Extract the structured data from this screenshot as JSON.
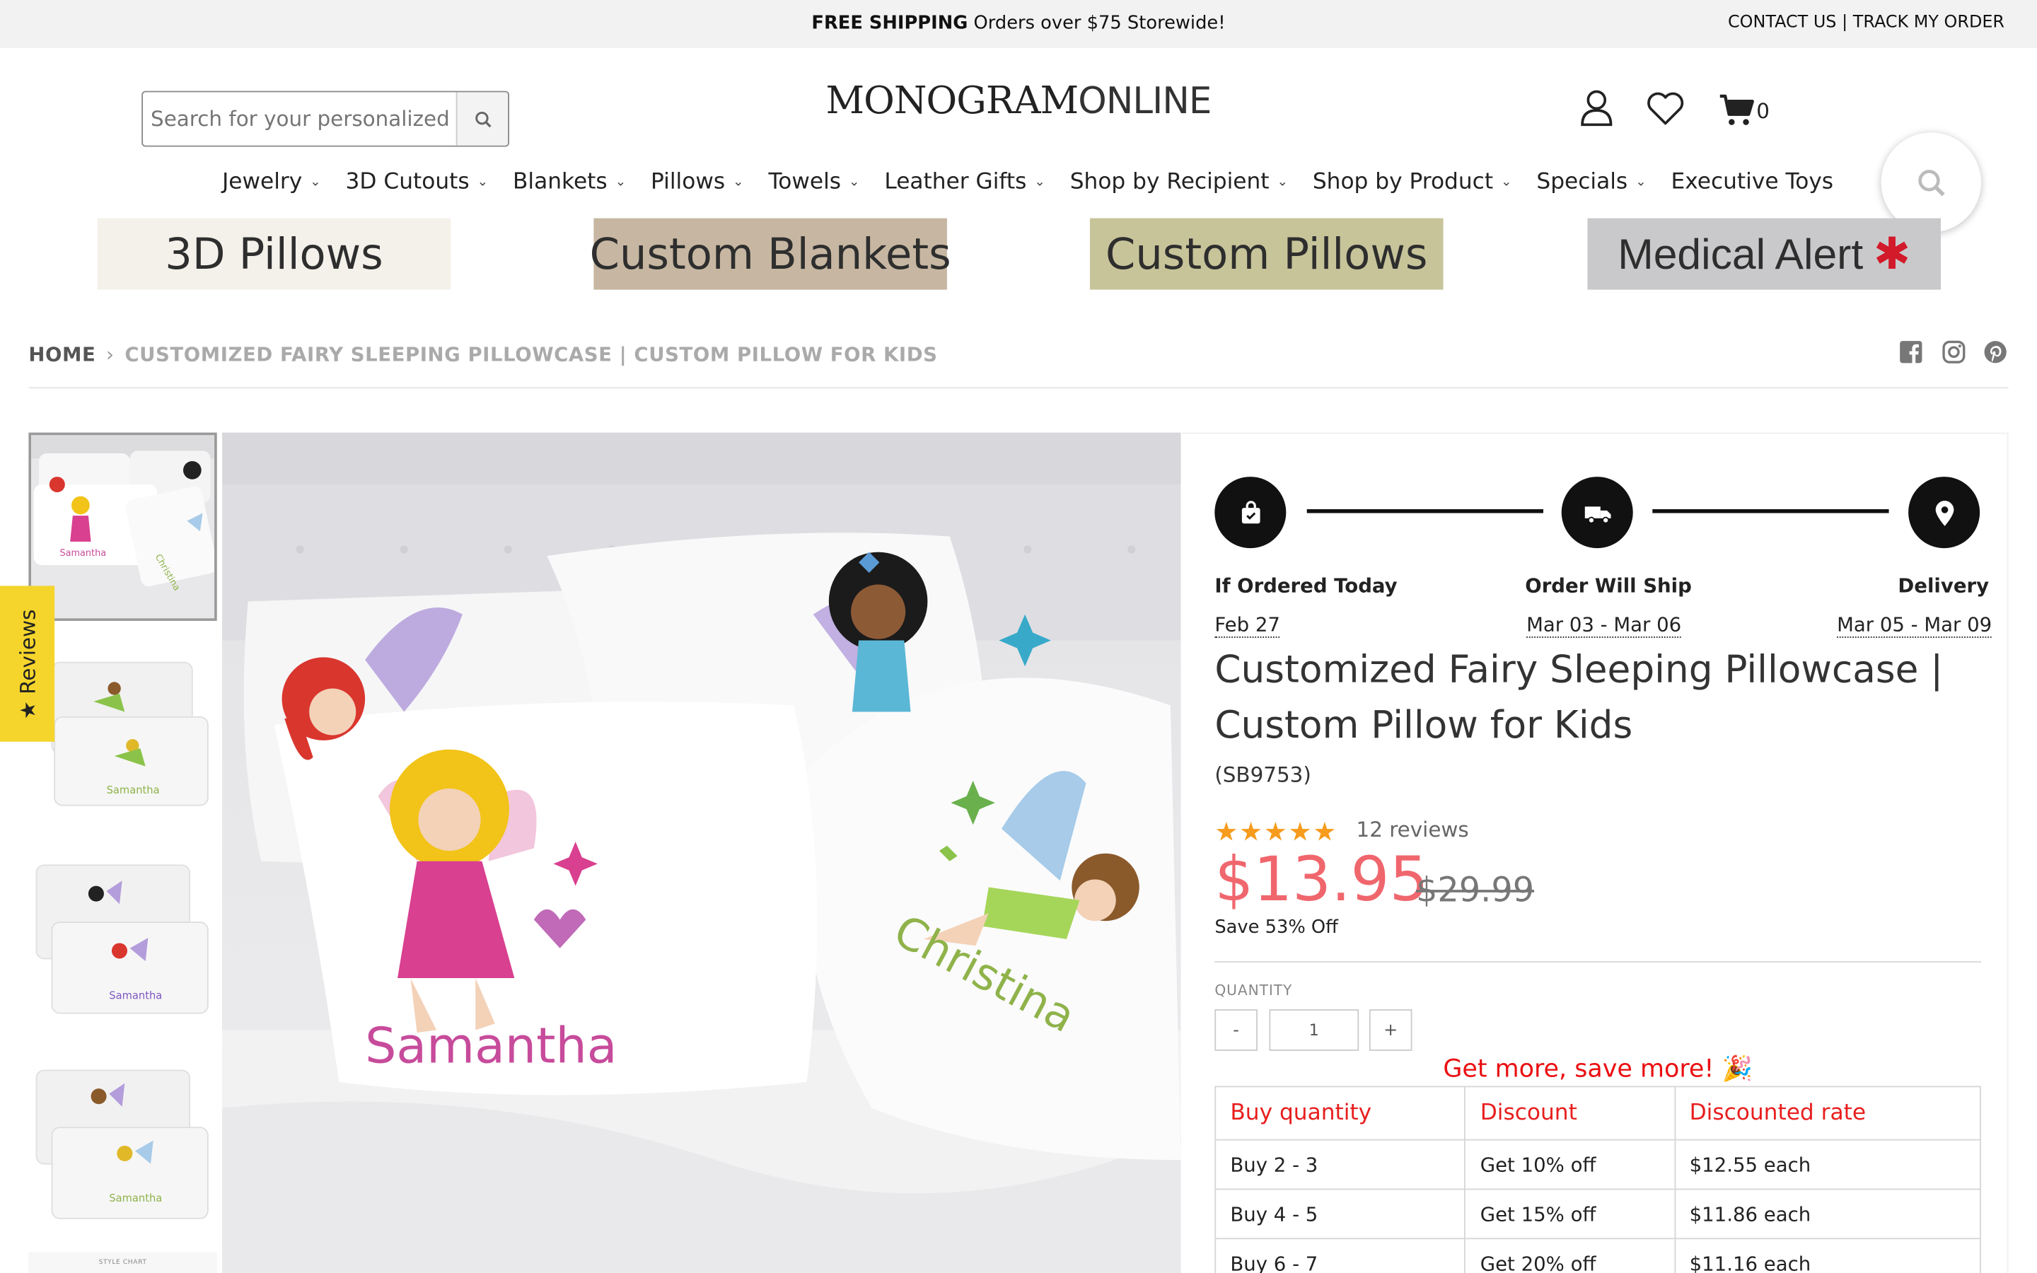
{
  "topbar": {
    "promo_bold": "FREE SHIPPING",
    "promo_rest": " Orders over $75 Storewide!",
    "contact": "CONTACT US",
    "link_sep": " | ",
    "track": "TRACK MY ORDER"
  },
  "header": {
    "search_placeholder": "Search for your personalized gift",
    "logo_main": "MONOGRAM",
    "logo_light": "ONLINE",
    "cart_count": "0"
  },
  "nav": {
    "items": [
      {
        "label": "Jewelry",
        "has_dropdown": true
      },
      {
        "label": "3D Cutouts",
        "has_dropdown": true
      },
      {
        "label": "Blankets",
        "has_dropdown": true
      },
      {
        "label": "Pillows",
        "has_dropdown": true
      },
      {
        "label": "Towels",
        "has_dropdown": true
      },
      {
        "label": "Leather Gifts",
        "has_dropdown": true
      },
      {
        "label": "Shop by Recipient",
        "has_dropdown": true
      },
      {
        "label": "Shop by Product",
        "has_dropdown": true
      },
      {
        "label": "Specials",
        "has_dropdown": true
      },
      {
        "label": "Executive Toys",
        "has_dropdown": false
      }
    ]
  },
  "banners": [
    {
      "label": "3D Pillows",
      "bg": "#f4f1ea"
    },
    {
      "label": "Custom Blankets",
      "bg": "#c7b7a2"
    },
    {
      "label": "Custom Pillows",
      "bg": "#c7c49a"
    },
    {
      "label": "Medical Alert",
      "bg": "#c9c9cb"
    }
  ],
  "breadcrumb": {
    "home": "HOME",
    "separator": "›",
    "current": "CUSTOMIZED FAIRY SLEEPING PILLOWCASE | CUSTOM PILLOW FOR KIDS"
  },
  "thumbnails": {
    "names": [
      "Samantha",
      "Christina",
      "Samantha",
      "Samantha",
      "Samantha"
    ],
    "style_chart": "STYLE CHART"
  },
  "main_image": {
    "name_left": "Samantha",
    "name_right": "Christina"
  },
  "reviews_tab": {
    "label": "★ Reviews"
  },
  "delivery": {
    "ordered_label": "If Ordered Today",
    "ordered_date": "Feb 27",
    "ship_label": "Order Will Ship",
    "ship_date": "Mar 03 - Mar 06",
    "delivery_label": "Delivery",
    "delivery_date": "Mar 05 - Mar 09"
  },
  "product": {
    "title": "Customized Fairy Sleeping Pillowcase | Custom Pillow for Kids",
    "sku": "(SB9753)",
    "rating": 5,
    "stars": "★★★★★",
    "reviews": "12 reviews",
    "price": "$13.95",
    "compare_price": "$29.99",
    "save": "Save 53% Off",
    "quantity_label": "QUANTITY",
    "quantity_value": "1",
    "minus": "-",
    "plus": "+"
  },
  "discounts": {
    "heading": "Get more, save more! 🎉",
    "headers": [
      "Buy quantity",
      "Discount",
      "Discounted rate"
    ],
    "rows": [
      [
        "Buy 2 - 3",
        "Get 10% off",
        "$12.55 each"
      ],
      [
        "Buy 4 - 5",
        "Get 15% off",
        "$11.86 each"
      ],
      [
        "Buy 6 - 7",
        "Get 20% off",
        "$11.16 each"
      ]
    ]
  },
  "colors": {
    "price": "#f0666d",
    "discount_header": "#e81e1e",
    "reviews_tab": "#f5d52c",
    "stars": "#f79b1c"
  }
}
